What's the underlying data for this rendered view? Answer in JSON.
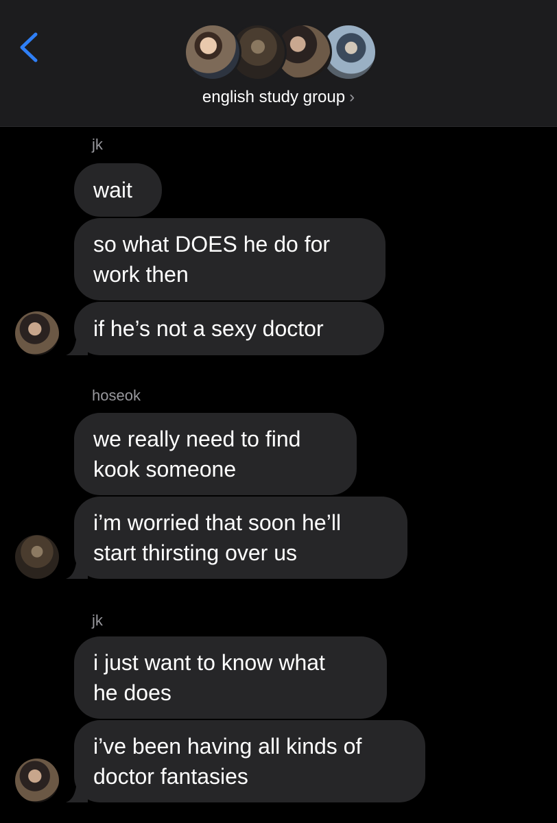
{
  "header": {
    "group_title": "english study group",
    "title_chevron": "›",
    "back_icon": "chevron-left-icon"
  },
  "colors": {
    "back_accent": "#2f7ff6",
    "bubble_bg": "#262628",
    "sender_name": "#98989d",
    "header_bg": "#1c1c1e"
  },
  "messages": [
    {
      "sender": "jk",
      "text": "wait"
    },
    {
      "text": "so what DOES he do for\nwork then"
    },
    {
      "text": "if he’s not a sexy doctor"
    },
    {
      "sender": "hoseok",
      "text": "we really need to find\nkook someone"
    },
    {
      "text": "i’m worried that soon he’ll\nstart thirsting over us"
    },
    {
      "sender": "jk",
      "text": "i just want to know what\nhe does"
    },
    {
      "text": "i’ve been having all kinds of\ndoctor fantasies"
    }
  ]
}
